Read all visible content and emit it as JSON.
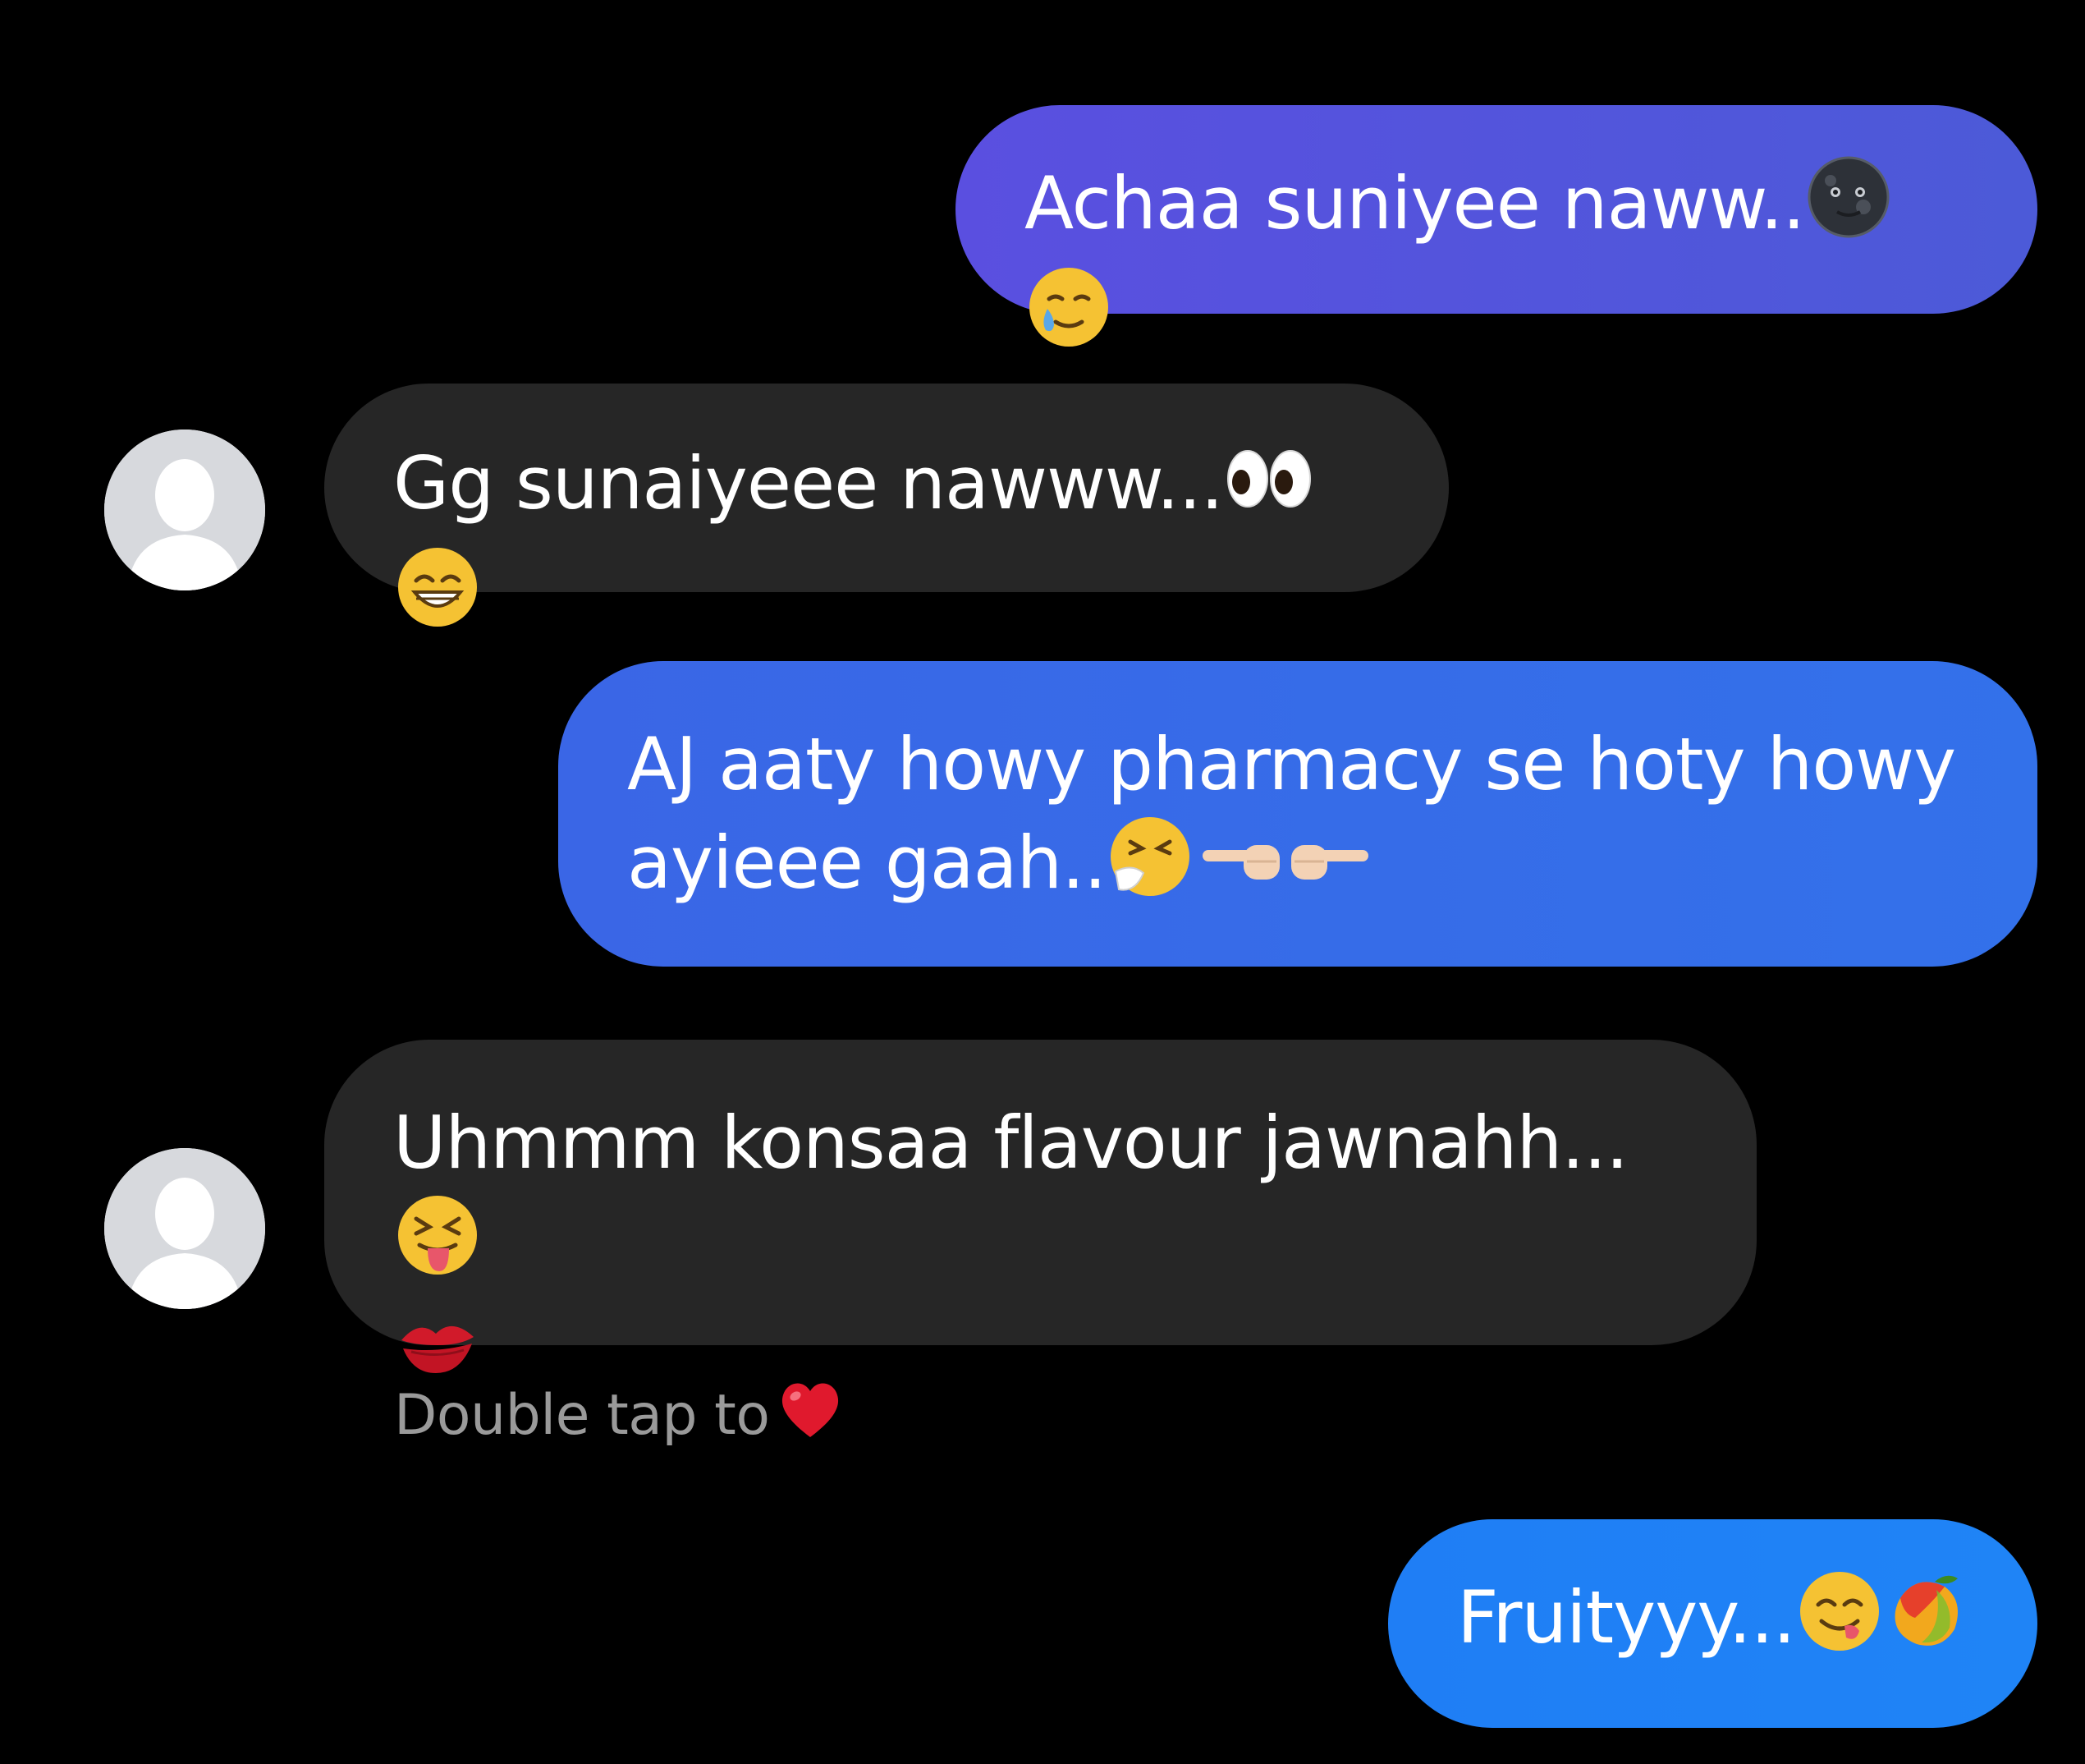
{
  "messages": [
    {
      "id": "m1",
      "direction": "sent",
      "text": "Achaa suniyee naww..",
      "emojis": [
        "new-moon-face",
        "smiling-face-with-tear"
      ]
    },
    {
      "id": "m2",
      "direction": "received",
      "text": "Gg sunaiyeee nawww...",
      "emojis": [
        "eyes",
        "beaming-face-with-smiling-eyes"
      ]
    },
    {
      "id": "m3",
      "direction": "sent",
      "text_line1": "AJ aaty howy pharmacy se hoty howy",
      "text_line2": "ayieee gaah..",
      "emojis": [
        "sneezing-face",
        "backhand-index-pointing-left",
        "backhand-index-pointing-right"
      ]
    },
    {
      "id": "m4",
      "direction": "received",
      "text": "Uhmmm konsaa flavour jawnahh...",
      "emojis": [
        "squinting-face-with-tongue",
        "kiss-mark"
      ]
    },
    {
      "id": "m5",
      "direction": "sent",
      "text": "Fruityyy...",
      "emojis": [
        "face-savoring-food",
        "mango"
      ]
    }
  ],
  "reaction_hint": {
    "text": "Double tap to",
    "emoji": "red-heart"
  },
  "colors": {
    "background": "#000000",
    "received_bubble": "#262626",
    "sent_bubble_1": "#5352dd",
    "sent_bubble_2": "#376cea",
    "sent_bubble_3": "#1f82f6",
    "hint_text": "#9a9a9a",
    "avatar_placeholder": "#d7d9dd"
  }
}
